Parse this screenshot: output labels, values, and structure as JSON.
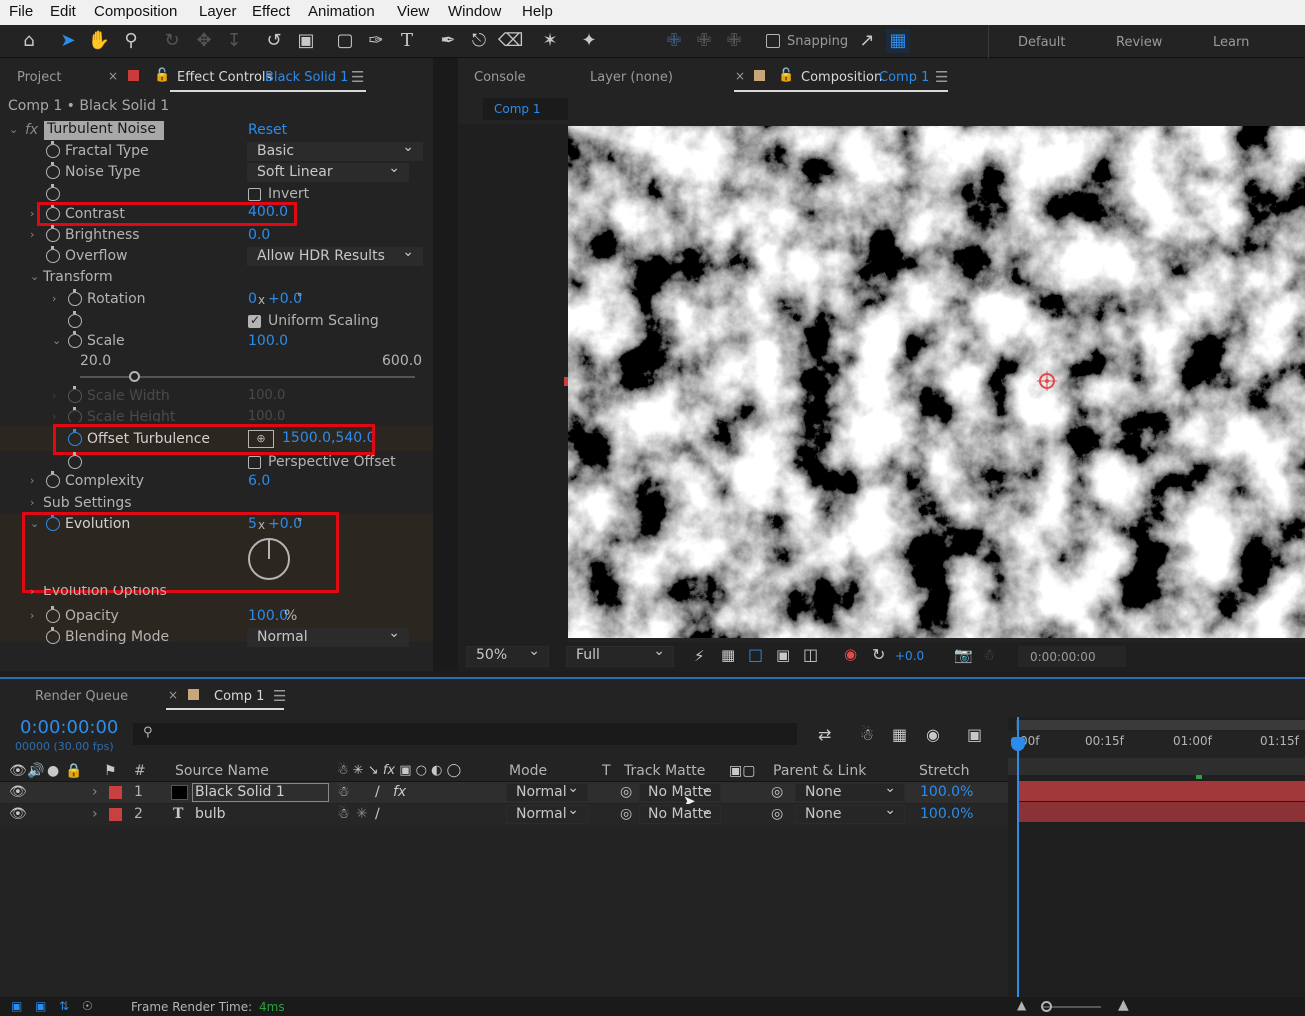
{
  "menu": [
    "File",
    "Edit",
    "Composition",
    "Layer",
    "Effect",
    "Animation",
    "View",
    "Window",
    "Help"
  ],
  "toolbar": {
    "snapping": "Snapping",
    "workspaces": [
      "Default",
      "Review",
      "Learn"
    ]
  },
  "left_panel": {
    "tabs": {
      "project": "Project",
      "effect_controls": "Effect Controls",
      "effect_layer": "Black Solid 1"
    },
    "breadcrumb": "Comp 1 • Black Solid 1",
    "effect": {
      "fx": "fx",
      "name": "Turbulent Noise",
      "reset": "Reset"
    },
    "props": {
      "fractal_type": {
        "label": "Fractal Type",
        "value": "Basic"
      },
      "noise_type": {
        "label": "Noise Type",
        "value": "Soft Linear"
      },
      "invert": {
        "label": "Invert"
      },
      "contrast": {
        "label": "Contrast",
        "value": "400.0"
      },
      "brightness": {
        "label": "Brightness",
        "value": "0.0"
      },
      "overflow": {
        "label": "Overflow",
        "value": "Allow HDR Results"
      },
      "transform": {
        "label": "Transform"
      },
      "rotation": {
        "label": "Rotation",
        "rev": "0",
        "x": "x",
        "deg": "+0.0",
        "unit": "°"
      },
      "uniform_scaling": {
        "label": "Uniform Scaling"
      },
      "scale": {
        "label": "Scale",
        "value": "100.0",
        "min": "20.0",
        "max": "600.0"
      },
      "scale_width": {
        "label": "Scale Width",
        "value": "100.0"
      },
      "scale_height": {
        "label": "Scale Height",
        "value": "100.0"
      },
      "offset_turbulence": {
        "label": "Offset Turbulence",
        "value": "1500.0,540.0"
      },
      "perspective_offset": {
        "label": "Perspective Offset"
      },
      "complexity": {
        "label": "Complexity",
        "value": "6.0"
      },
      "sub_settings": {
        "label": "Sub Settings"
      },
      "evolution": {
        "label": "Evolution",
        "rev": "5",
        "x": "x",
        "deg": "+0.0",
        "unit": "°"
      },
      "evolution_options": {
        "label": "Evolution Options"
      },
      "opacity": {
        "label": "Opacity",
        "value": "100.0",
        "unit": "%"
      },
      "blending_mode": {
        "label": "Blending Mode",
        "value": "Normal"
      }
    }
  },
  "comp_panel": {
    "tabs": {
      "console": "Console",
      "layer": "Layer (none)",
      "composition": "Composition",
      "comp": "Comp 1"
    },
    "comp_tab": "Comp 1",
    "zoom": "50%",
    "resolution": "Full",
    "exposure": "+0.0",
    "timecode": "0:00:00:00"
  },
  "timeline": {
    "tabs": {
      "render_queue": "Render Queue",
      "comp": "Comp 1"
    },
    "timecode": "0:00:00:00",
    "frames": "00000 (30.00 fps)",
    "columns": {
      "num": "#",
      "source": "Source Name",
      "mode": "Mode",
      "t": "T",
      "track_matte": "Track Matte",
      "parent": "Parent & Link",
      "stretch": "Stretch"
    },
    "ruler": [
      "00f",
      "00:15f",
      "01:00f",
      "01:15f"
    ],
    "layers": [
      {
        "num": "1",
        "name": "Black Solid 1",
        "mode": "Normal",
        "matte": "No Matte",
        "parent": "None",
        "stretch": "100.0%"
      },
      {
        "num": "2",
        "type": "T",
        "name": "bulb",
        "mode": "Normal",
        "matte": "No Matte",
        "parent": "None",
        "stretch": "100.0%"
      }
    ],
    "status": {
      "label": "Frame Render Time:",
      "value": "4ms"
    }
  }
}
